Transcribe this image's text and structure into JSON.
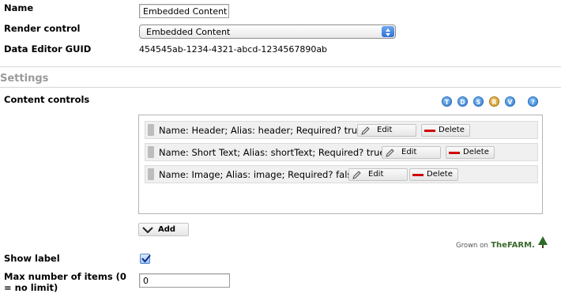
{
  "fields": {
    "name_label": "Name",
    "name_value": "Embedded Content",
    "render_label": "Render control",
    "render_value": "Embedded Content",
    "guid_label": "Data Editor GUID",
    "guid_value": "454545ab-1234-4321-abcd-1234567890ab"
  },
  "settings": {
    "title": "Settings",
    "content_controls_label": "Content controls",
    "toolbar_icons": [
      {
        "letter": "T",
        "icon": "text-type-icon"
      },
      {
        "letter": "D",
        "icon": "date-type-icon"
      },
      {
        "letter": "S",
        "icon": "select-type-icon"
      },
      {
        "letter": "R",
        "icon": "richtext-type-icon",
        "color": "#c8921d"
      },
      {
        "letter": "V",
        "icon": "v-type-icon"
      },
      {
        "letter": "?",
        "icon": "help-icon"
      }
    ],
    "rows": [
      {
        "text": "Name: Header; Alias: header; Required? true;",
        "edit": "Edit",
        "delete": "Delete"
      },
      {
        "text": "Name: Short Text; Alias: shortText; Required? true;",
        "edit": "Edit",
        "delete": "Delete"
      },
      {
        "text": "Name: Image; Alias: image; Required? false;",
        "edit": "Edit",
        "delete": "Delete"
      }
    ],
    "add_label": "Add",
    "grown_on": "Grown on",
    "brand": "TheFARM.",
    "show_label_label": "Show label",
    "show_label_checked": true,
    "max_items_label": "Max number of items (0 = no limit)",
    "max_items_value": "0"
  },
  "colors": {
    "delete_red": "#d00000",
    "accent_blue": "#2c79cd",
    "brand_green": "#3a6a2a"
  }
}
